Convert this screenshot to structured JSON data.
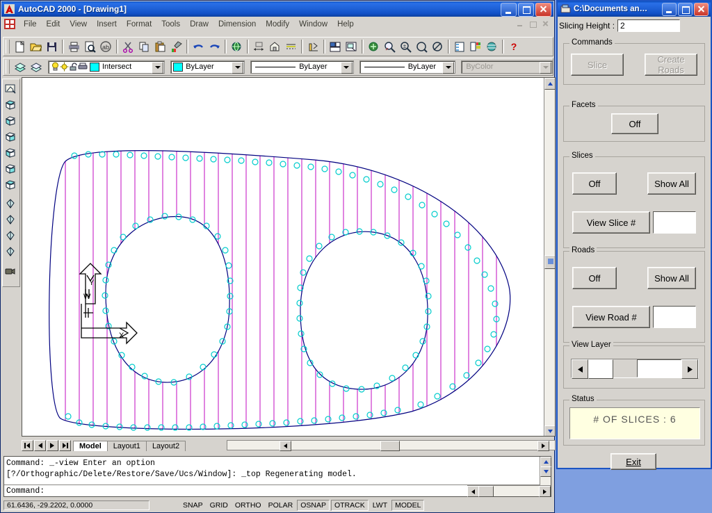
{
  "app": {
    "title": "AutoCAD 2000 - [Drawing1]",
    "title_icon": "autocad-logo-icon",
    "menu": [
      "File",
      "Edit",
      "View",
      "Insert",
      "Format",
      "Tools",
      "Draw",
      "Dimension",
      "Modify",
      "Window",
      "Help"
    ]
  },
  "standard_toolbar": [
    {
      "name": "new-file-icon"
    },
    {
      "name": "open-file-icon"
    },
    {
      "name": "save-file-icon"
    },
    {
      "sep": true
    },
    {
      "name": "print-icon"
    },
    {
      "name": "print-preview-icon"
    },
    {
      "name": "spell-check-icon"
    },
    {
      "sep": true
    },
    {
      "name": "cut-icon"
    },
    {
      "name": "copy-icon"
    },
    {
      "name": "paste-icon"
    },
    {
      "name": "match-properties-icon"
    },
    {
      "sep": true
    },
    {
      "name": "undo-icon"
    },
    {
      "name": "redo-icon"
    },
    {
      "sep": true
    },
    {
      "name": "insert-hyperlink-icon"
    },
    {
      "sep": true
    },
    {
      "name": "distance-icon"
    },
    {
      "name": "block-insert-icon"
    },
    {
      "name": "dimension-style-icon"
    },
    {
      "sep": true
    },
    {
      "name": "ucs-icon"
    },
    {
      "sep": true
    },
    {
      "name": "named-views-icon"
    },
    {
      "name": "viewports-icon"
    },
    {
      "sep": true
    },
    {
      "name": "pan-realtime-icon"
    },
    {
      "name": "zoom-realtime-icon"
    },
    {
      "name": "zoom-window-icon"
    },
    {
      "name": "zoom-previous-icon"
    },
    {
      "sep": true
    },
    {
      "name": "properties-icon"
    },
    {
      "name": "design-center-icon"
    },
    {
      "name": "today-icon"
    },
    {
      "sep": true
    },
    {
      "name": "help-icon"
    }
  ],
  "properties_toolbar": {
    "layers_icon": "layers-icon",
    "layer_previous_icon": "layer-previous-icon",
    "layer_state": {
      "light_icon": "lightbulb-on-icon",
      "freeze_icon": "sun-freeze-icon",
      "lock_icon": "unlocked-padlock-icon",
      "plot_icon": "plotter-icon",
      "color": "#00ffff",
      "name": "Intersect"
    },
    "color_control": {
      "color": "#00ffff",
      "value": "ByLayer"
    },
    "linetype_control": {
      "value": "ByLayer"
    },
    "lineweight_control": {
      "value": "ByLayer"
    },
    "plotstyle_control": {
      "value": "ByColor",
      "disabled": true
    }
  },
  "view_toolbar": [
    {
      "name": "named-views-icon"
    },
    {
      "name": "top-view-icon"
    },
    {
      "name": "bottom-view-icon"
    },
    {
      "name": "left-view-icon"
    },
    {
      "name": "right-view-icon"
    },
    {
      "name": "front-view-icon"
    },
    {
      "name": "back-view-icon"
    },
    {
      "name": "sw-isometric-view-icon"
    },
    {
      "name": "se-isometric-view-icon"
    },
    {
      "name": "ne-isometric-view-icon"
    },
    {
      "name": "nw-isometric-view-icon"
    },
    {
      "name": "camera-icon"
    }
  ],
  "drawing": {
    "ucs_icon": {
      "x_label": "X",
      "y_label": "Y",
      "world_label": "W"
    },
    "colors": {
      "hatch": "#cc33cc",
      "outline": "#000080",
      "nodes": "#00cccc",
      "background": "#ffffff"
    },
    "layout_tabs": [
      {
        "label": "Model",
        "active": true
      },
      {
        "label": "Layout1",
        "active": false
      },
      {
        "label": "Layout2",
        "active": false
      }
    ],
    "nav_buttons": [
      "first-layout-icon",
      "previous-layout-icon",
      "next-layout-icon",
      "last-layout-icon"
    ]
  },
  "command_window": {
    "lines": [
      "Command: _-view Enter an option",
      "[?/Orthographic/Delete/Restore/Save/Ucs/Window]: _top Regenerating model.",
      "Command:"
    ]
  },
  "status_bar": {
    "coordinates": "61.6436, -29.2202, 0.0000",
    "toggles": [
      {
        "label": "SNAP",
        "on": false
      },
      {
        "label": "GRID",
        "on": false
      },
      {
        "label": "ORTHO",
        "on": false
      },
      {
        "label": "POLAR",
        "on": false
      },
      {
        "label": "OSNAP",
        "on": true
      },
      {
        "label": "OTRACK",
        "on": true
      },
      {
        "label": "LWT",
        "on": false
      },
      {
        "label": "MODEL",
        "on": true
      }
    ]
  },
  "dialog": {
    "title": "C:\\Documents an…",
    "title_icon": "folder-window-icon",
    "slicing_height": {
      "label": "Slicing Height :",
      "value": "2"
    },
    "commands": {
      "legend": "Commands",
      "slice_button": {
        "label": "Slice",
        "disabled": true
      },
      "create_roads_button": {
        "label": "Create Roads",
        "disabled": true
      }
    },
    "facets": {
      "legend": "Facets",
      "toggle_label": "Off"
    },
    "slices": {
      "legend": "Slices",
      "toggle_label": "Off",
      "show_all_label": "Show All",
      "view_label": "View Slice #",
      "view_value": ""
    },
    "roads": {
      "legend": "Roads",
      "toggle_label": "Off",
      "show_all_label": "Show All",
      "view_label": "View Road #",
      "view_value": ""
    },
    "view_layer": {
      "legend": "View Layer",
      "value": ""
    },
    "status": {
      "legend": "Status",
      "text": "# OF SLICES : 6"
    },
    "exit_button": "Exit"
  }
}
